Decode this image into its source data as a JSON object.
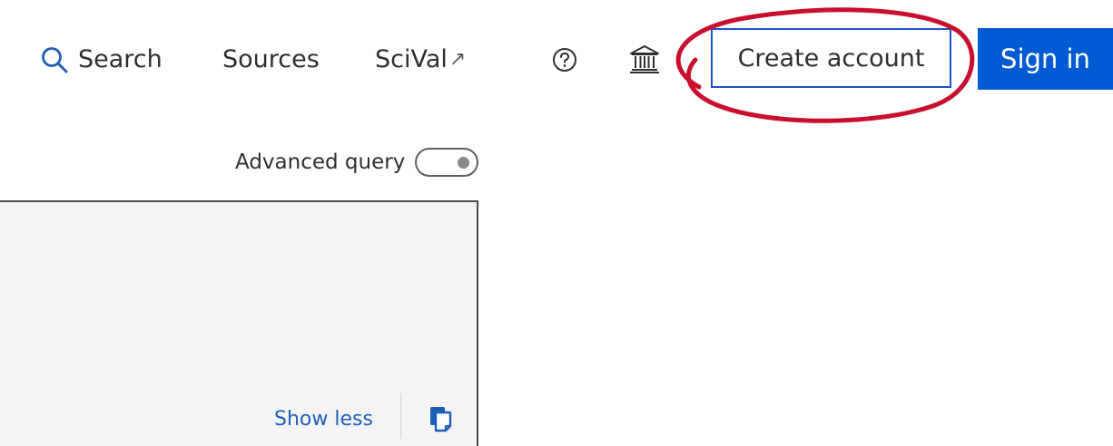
{
  "header": {
    "nav": {
      "search_label": "Search",
      "sources_label": "Sources",
      "scival_label": "SciVal",
      "scival_external_glyph": "↗"
    },
    "icons": {
      "search": "search-icon",
      "help": "help-icon",
      "institution": "institution-icon",
      "copy": "copy-icon"
    },
    "create_account_label": "Create account",
    "sign_in_label": "Sign in"
  },
  "advanced_query": {
    "label": "Advanced query",
    "enabled": false
  },
  "query_panel": {
    "show_less_label": "Show less"
  },
  "colors": {
    "brand_blue": "#005ad2",
    "link_blue": "#1f5fb8",
    "annotation_red": "#c8102e",
    "panel_bg": "#f4f4f4"
  }
}
